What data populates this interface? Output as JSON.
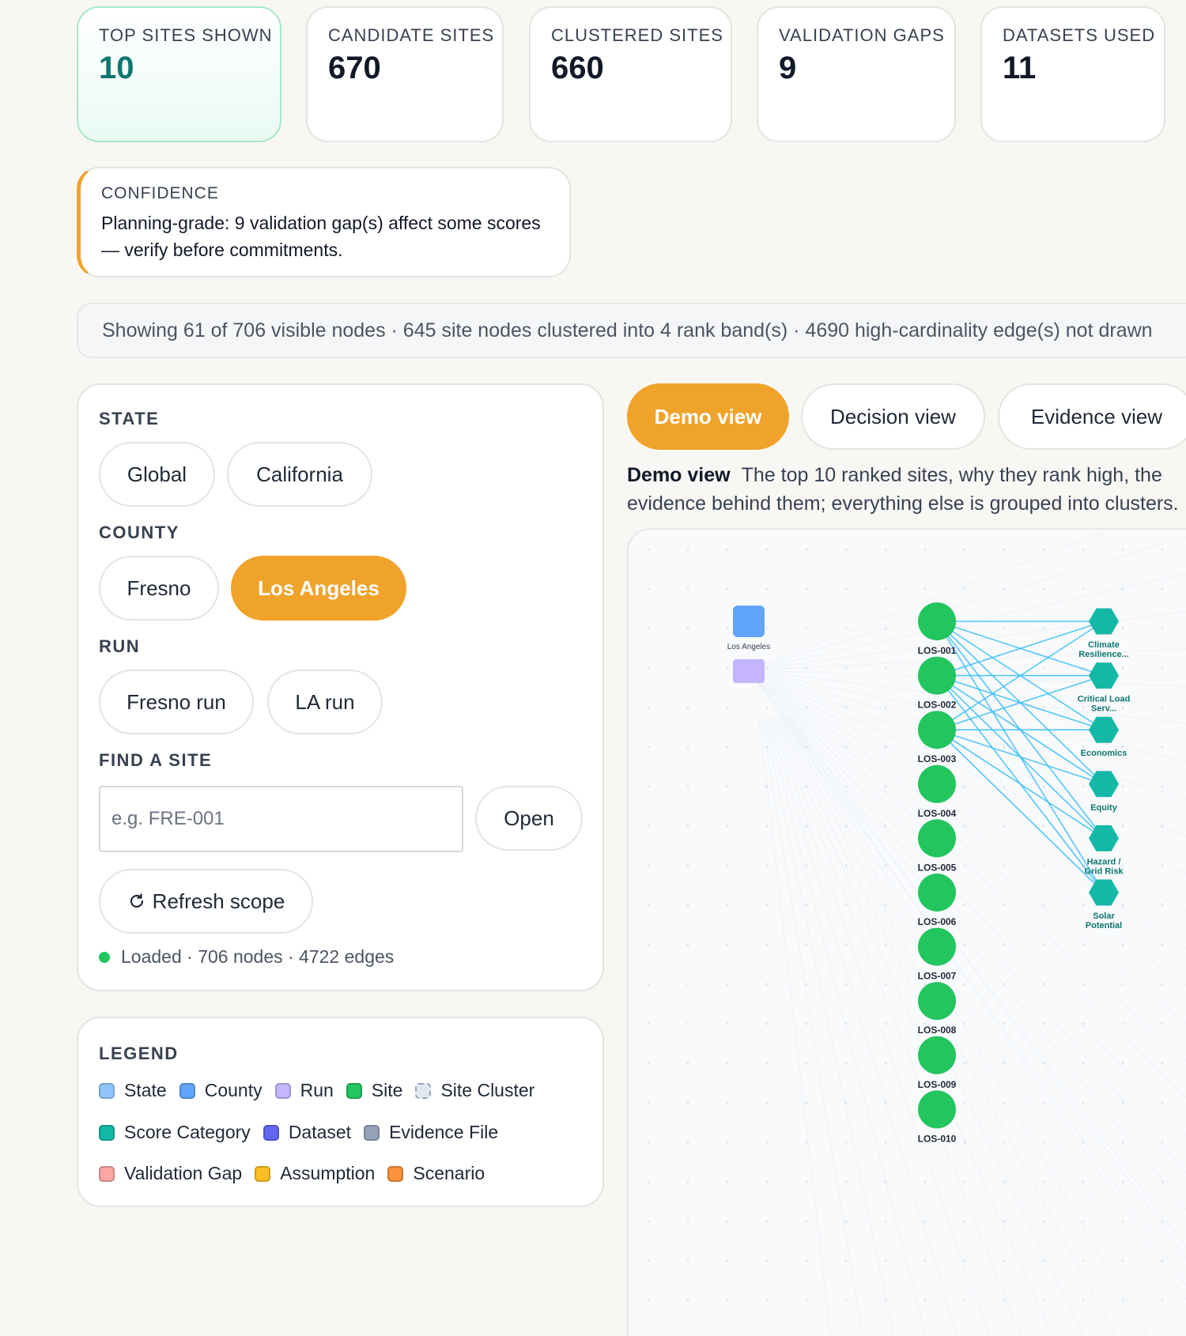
{
  "kpis": [
    {
      "label": "TOP SITES SHOWN",
      "value": "10"
    },
    {
      "label": "CANDIDATE SITES",
      "value": "670"
    },
    {
      "label": "CLUSTERED SITES",
      "value": "660"
    },
    {
      "label": "VALIDATION GAPS",
      "value": "9"
    },
    {
      "label": "DATASETS USED",
      "value": "11"
    }
  ],
  "confidence": {
    "label": "CONFIDENCE",
    "text": "Planning-grade: 9 validation gap(s) affect some scores — verify before commitments.",
    "accent": "#f0a32a"
  },
  "summary": "Showing 61 of 706 visible nodes · 645 site nodes clustered into 4 rank band(s) · 4690 high-cardinality edge(s) not drawn",
  "filters": {
    "state_title": "STATE",
    "state_options": [
      "Global",
      "California"
    ],
    "county_title": "COUNTY",
    "county_options": [
      "Fresno",
      "Los Angeles"
    ],
    "county_selected": "Los Angeles",
    "run_title": "RUN",
    "run_options": [
      "Fresno run",
      "LA run"
    ],
    "find_title": "FIND A SITE",
    "find_placeholder": "e.g. FRE-001",
    "open_label": "Open",
    "refresh_label": "Refresh scope",
    "refresh_icon": "refresh-icon",
    "status": "Loaded · 706 nodes · 4722 edges",
    "status_color": "#22c55e"
  },
  "legend": {
    "title": "LEGEND",
    "items": [
      {
        "label": "State",
        "color": "#93c5fd"
      },
      {
        "label": "County",
        "color": "#60a5fa"
      },
      {
        "label": "Run",
        "color": "#c4b5fd"
      },
      {
        "label": "Site",
        "color": "#22c55e"
      },
      {
        "label": "Site Cluster",
        "color": "#e2e8f0"
      },
      {
        "label": "Score Category",
        "color": "#14b8a6"
      },
      {
        "label": "Dataset",
        "color": "#6366f1"
      },
      {
        "label": "Evidence File",
        "color": "#94a3b8"
      },
      {
        "label": "Validation Gap",
        "color": "#fca5a5"
      },
      {
        "label": "Assumption",
        "color": "#fbbf24"
      },
      {
        "label": "Scenario",
        "color": "#fb923c"
      }
    ]
  },
  "views": {
    "tabs": [
      "Demo view",
      "Decision view",
      "Evidence view"
    ],
    "active": "Demo view",
    "desc_title": "Demo view",
    "desc_text": "The top 10 ranked sites, why they rank high, the evidence behind them; everything else is grouped into clusters."
  },
  "graph": {
    "county_label": "Los Angeles",
    "sites": [
      "LOS-001",
      "LOS-002",
      "LOS-003",
      "LOS-004",
      "LOS-005",
      "LOS-006",
      "LOS-007",
      "LOS-008",
      "LOS-009",
      "LOS-010"
    ],
    "categories": [
      "Climate Resilience...",
      "Critical Load Serv...",
      "Economics",
      "Equity",
      "Hazard / Grid Risk",
      "Solar Potential"
    ],
    "colors": {
      "site": "#22c55e",
      "category": "#14b8a6",
      "county": "#60a5fa",
      "run": "#c4b5fd",
      "edge": "#38bdf8"
    }
  }
}
